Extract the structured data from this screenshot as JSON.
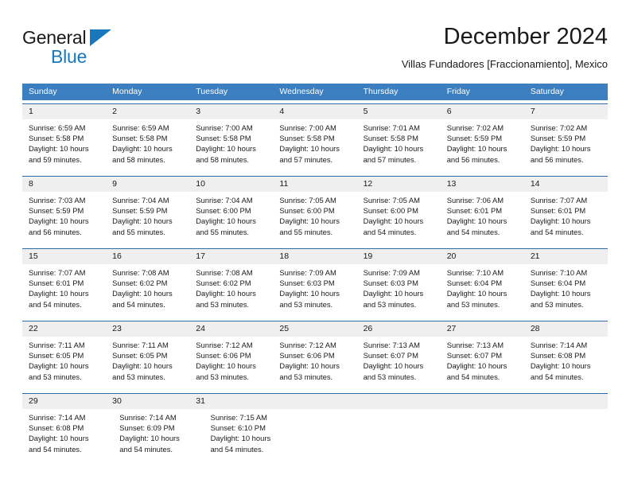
{
  "brand": {
    "name_part1": "General",
    "name_part2": "Blue",
    "accent_color": "#1878be",
    "triangle_icon": "triangle-icon"
  },
  "header": {
    "title": "December 2024",
    "subtitle": "Villas Fundadores [Fraccionamiento], Mexico"
  },
  "calendar": {
    "header_bg": "#3c7fc1",
    "row_divider_color": "#2d6ca8",
    "daynum_bg": "#efefef",
    "weekday_headers": [
      "Sunday",
      "Monday",
      "Tuesday",
      "Wednesday",
      "Thursday",
      "Friday",
      "Saturday"
    ],
    "weeks": [
      {
        "days": [
          {
            "day": "1",
            "sunrise": "Sunrise: 6:59 AM",
            "sunset": "Sunset: 5:58 PM",
            "daylight1": "Daylight: 10 hours",
            "daylight2": "and 59 minutes."
          },
          {
            "day": "2",
            "sunrise": "Sunrise: 6:59 AM",
            "sunset": "Sunset: 5:58 PM",
            "daylight1": "Daylight: 10 hours",
            "daylight2": "and 58 minutes."
          },
          {
            "day": "3",
            "sunrise": "Sunrise: 7:00 AM",
            "sunset": "Sunset: 5:58 PM",
            "daylight1": "Daylight: 10 hours",
            "daylight2": "and 58 minutes."
          },
          {
            "day": "4",
            "sunrise": "Sunrise: 7:00 AM",
            "sunset": "Sunset: 5:58 PM",
            "daylight1": "Daylight: 10 hours",
            "daylight2": "and 57 minutes."
          },
          {
            "day": "5",
            "sunrise": "Sunrise: 7:01 AM",
            "sunset": "Sunset: 5:58 PM",
            "daylight1": "Daylight: 10 hours",
            "daylight2": "and 57 minutes."
          },
          {
            "day": "6",
            "sunrise": "Sunrise: 7:02 AM",
            "sunset": "Sunset: 5:59 PM",
            "daylight1": "Daylight: 10 hours",
            "daylight2": "and 56 minutes."
          },
          {
            "day": "7",
            "sunrise": "Sunrise: 7:02 AM",
            "sunset": "Sunset: 5:59 PM",
            "daylight1": "Daylight: 10 hours",
            "daylight2": "and 56 minutes."
          }
        ]
      },
      {
        "days": [
          {
            "day": "8",
            "sunrise": "Sunrise: 7:03 AM",
            "sunset": "Sunset: 5:59 PM",
            "daylight1": "Daylight: 10 hours",
            "daylight2": "and 56 minutes."
          },
          {
            "day": "9",
            "sunrise": "Sunrise: 7:04 AM",
            "sunset": "Sunset: 5:59 PM",
            "daylight1": "Daylight: 10 hours",
            "daylight2": "and 55 minutes."
          },
          {
            "day": "10",
            "sunrise": "Sunrise: 7:04 AM",
            "sunset": "Sunset: 6:00 PM",
            "daylight1": "Daylight: 10 hours",
            "daylight2": "and 55 minutes."
          },
          {
            "day": "11",
            "sunrise": "Sunrise: 7:05 AM",
            "sunset": "Sunset: 6:00 PM",
            "daylight1": "Daylight: 10 hours",
            "daylight2": "and 55 minutes."
          },
          {
            "day": "12",
            "sunrise": "Sunrise: 7:05 AM",
            "sunset": "Sunset: 6:00 PM",
            "daylight1": "Daylight: 10 hours",
            "daylight2": "and 54 minutes."
          },
          {
            "day": "13",
            "sunrise": "Sunrise: 7:06 AM",
            "sunset": "Sunset: 6:01 PM",
            "daylight1": "Daylight: 10 hours",
            "daylight2": "and 54 minutes."
          },
          {
            "day": "14",
            "sunrise": "Sunrise: 7:07 AM",
            "sunset": "Sunset: 6:01 PM",
            "daylight1": "Daylight: 10 hours",
            "daylight2": "and 54 minutes."
          }
        ]
      },
      {
        "days": [
          {
            "day": "15",
            "sunrise": "Sunrise: 7:07 AM",
            "sunset": "Sunset: 6:01 PM",
            "daylight1": "Daylight: 10 hours",
            "daylight2": "and 54 minutes."
          },
          {
            "day": "16",
            "sunrise": "Sunrise: 7:08 AM",
            "sunset": "Sunset: 6:02 PM",
            "daylight1": "Daylight: 10 hours",
            "daylight2": "and 54 minutes."
          },
          {
            "day": "17",
            "sunrise": "Sunrise: 7:08 AM",
            "sunset": "Sunset: 6:02 PM",
            "daylight1": "Daylight: 10 hours",
            "daylight2": "and 53 minutes."
          },
          {
            "day": "18",
            "sunrise": "Sunrise: 7:09 AM",
            "sunset": "Sunset: 6:03 PM",
            "daylight1": "Daylight: 10 hours",
            "daylight2": "and 53 minutes."
          },
          {
            "day": "19",
            "sunrise": "Sunrise: 7:09 AM",
            "sunset": "Sunset: 6:03 PM",
            "daylight1": "Daylight: 10 hours",
            "daylight2": "and 53 minutes."
          },
          {
            "day": "20",
            "sunrise": "Sunrise: 7:10 AM",
            "sunset": "Sunset: 6:04 PM",
            "daylight1": "Daylight: 10 hours",
            "daylight2": "and 53 minutes."
          },
          {
            "day": "21",
            "sunrise": "Sunrise: 7:10 AM",
            "sunset": "Sunset: 6:04 PM",
            "daylight1": "Daylight: 10 hours",
            "daylight2": "and 53 minutes."
          }
        ]
      },
      {
        "days": [
          {
            "day": "22",
            "sunrise": "Sunrise: 7:11 AM",
            "sunset": "Sunset: 6:05 PM",
            "daylight1": "Daylight: 10 hours",
            "daylight2": "and 53 minutes."
          },
          {
            "day": "23",
            "sunrise": "Sunrise: 7:11 AM",
            "sunset": "Sunset: 6:05 PM",
            "daylight1": "Daylight: 10 hours",
            "daylight2": "and 53 minutes."
          },
          {
            "day": "24",
            "sunrise": "Sunrise: 7:12 AM",
            "sunset": "Sunset: 6:06 PM",
            "daylight1": "Daylight: 10 hours",
            "daylight2": "and 53 minutes."
          },
          {
            "day": "25",
            "sunrise": "Sunrise: 7:12 AM",
            "sunset": "Sunset: 6:06 PM",
            "daylight1": "Daylight: 10 hours",
            "daylight2": "and 53 minutes."
          },
          {
            "day": "26",
            "sunrise": "Sunrise: 7:13 AM",
            "sunset": "Sunset: 6:07 PM",
            "daylight1": "Daylight: 10 hours",
            "daylight2": "and 53 minutes."
          },
          {
            "day": "27",
            "sunrise": "Sunrise: 7:13 AM",
            "sunset": "Sunset: 6:07 PM",
            "daylight1": "Daylight: 10 hours",
            "daylight2": "and 54 minutes."
          },
          {
            "day": "28",
            "sunrise": "Sunrise: 7:14 AM",
            "sunset": "Sunset: 6:08 PM",
            "daylight1": "Daylight: 10 hours",
            "daylight2": "and 54 minutes."
          }
        ]
      },
      {
        "days": [
          {
            "day": "29",
            "sunrise": "Sunrise: 7:14 AM",
            "sunset": "Sunset: 6:08 PM",
            "daylight1": "Daylight: 10 hours",
            "daylight2": "and 54 minutes."
          },
          {
            "day": "30",
            "sunrise": "Sunrise: 7:14 AM",
            "sunset": "Sunset: 6:09 PM",
            "daylight1": "Daylight: 10 hours",
            "daylight2": "and 54 minutes."
          },
          {
            "day": "31",
            "sunrise": "Sunrise: 7:15 AM",
            "sunset": "Sunset: 6:10 PM",
            "daylight1": "Daylight: 10 hours",
            "daylight2": "and 54 minutes."
          },
          {
            "day": "",
            "sunrise": "",
            "sunset": "",
            "daylight1": "",
            "daylight2": ""
          },
          {
            "day": "",
            "sunrise": "",
            "sunset": "",
            "daylight1": "",
            "daylight2": ""
          },
          {
            "day": "",
            "sunrise": "",
            "sunset": "",
            "daylight1": "",
            "daylight2": ""
          },
          {
            "day": "",
            "sunrise": "",
            "sunset": "",
            "daylight1": "",
            "daylight2": ""
          }
        ]
      }
    ]
  }
}
